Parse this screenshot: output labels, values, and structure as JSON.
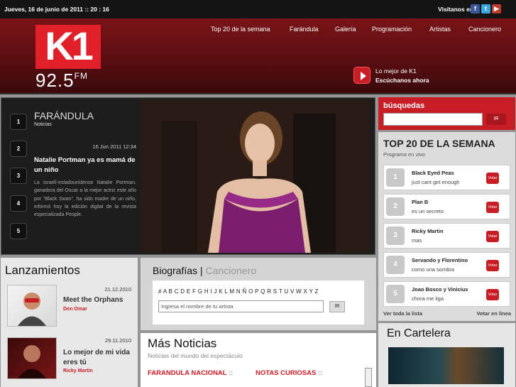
{
  "topbar": {
    "date": "Jueves, 16 de junio de 2011 :: 20 : 16",
    "visit_label": "Visítanos en"
  },
  "brand": {
    "logo": "K1",
    "frequency": "92.5",
    "fm": "FM"
  },
  "nav": [
    "Top 20 de la semana",
    "Farándula",
    "Galería",
    "Programación",
    "Artistas",
    "Cancionero"
  ],
  "listen": {
    "line1": "Lo mejor de K1",
    "line2": "Escúchanos ahora"
  },
  "feature": {
    "numbers": [
      "1",
      "2",
      "3",
      "4",
      "5"
    ],
    "section": "FARÁNDULA",
    "subsection": "Noticias",
    "date": "16 Jun 2011 12:34",
    "headline": "Natalie Portman ya es mamá de un niño",
    "body": "La israelí-estadounidense Natalie Portman, ganadora del Oscar a la mejor actriz este año por \"Black Swan\", ha sido madre de un niño, informó hoy la edición digital de la revista especializada People."
  },
  "search": {
    "label": "búsquedas",
    "button": "IR"
  },
  "top20": {
    "title": "TOP 20 DE LA SEMANA",
    "subtitle": "Programa en vivo",
    "vote_label": "Votar",
    "items": [
      {
        "n": "1",
        "artist": "Black Eyed Peas",
        "song": "just cant get enough"
      },
      {
        "n": "2",
        "artist": "Plan B",
        "song": "es un secreto"
      },
      {
        "n": "3",
        "artist": "Ricky Martin",
        "song": "mas"
      },
      {
        "n": "4",
        "artist": "Servando y Florentino",
        "song": "como una sombra"
      },
      {
        "n": "5",
        "artist": "Joao Bosco y Vinicius",
        "song": "chora me liga"
      }
    ],
    "see_all": "Ver toda la lista",
    "vote_online": "Votar en línea"
  },
  "cartelera": {
    "title": "En Cartelera"
  },
  "lanzamientos": {
    "title": "Lanzamientos",
    "items": [
      {
        "date": "21.12.2010",
        "title": "Meet the Orphans",
        "artist": "Don Omar"
      },
      {
        "date": "29.11.2010",
        "title": "Lo mejor de mi vida eres tú",
        "artist": "Ricky Martin"
      }
    ]
  },
  "bio": {
    "tab_active": "Biografías",
    "tab_sep": "|",
    "tab_inactive": "Cancionero",
    "letters": "# A B C D E F G H I J K L M N Ñ O P Q R S T U V W X Y Z",
    "placeholder": "Ingresa el nombre de tu artista",
    "button": "IR"
  },
  "news": {
    "title": "Más Noticias",
    "subtitle": "Noticias del mundo del espectáculo",
    "cat1": "FARANDULA NACIONAL",
    "cat2": "NOTAS CURIOSAS",
    "cat_sep": "::"
  }
}
